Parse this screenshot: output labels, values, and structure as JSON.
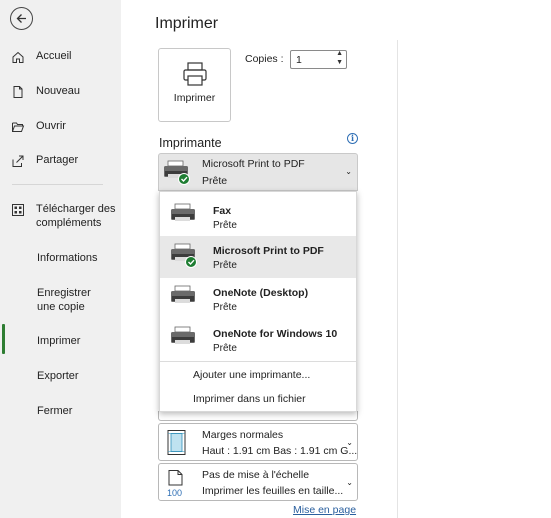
{
  "sidebar": {
    "back_label": "",
    "items": [
      {
        "label": "Accueil",
        "icon": "home-icon"
      },
      {
        "label": "Nouveau",
        "icon": "new-document-icon"
      },
      {
        "label": "Ouvrir",
        "icon": "folder-open-icon"
      },
      {
        "label": "Partager",
        "icon": "share-icon"
      },
      {
        "label": "Télécharger des compléments",
        "icon": "addins-icon"
      },
      {
        "label": "Informations"
      },
      {
        "label": "Enregistrer une copie"
      },
      {
        "label": "Imprimer",
        "active": true
      },
      {
        "label": "Exporter"
      },
      {
        "label": "Fermer"
      }
    ]
  },
  "main": {
    "title": "Imprimer",
    "print_button_label": "Imprimer",
    "copies_label": "Copies :",
    "copies_value": "1",
    "printer_section_title": "Imprimante",
    "selected_printer": {
      "name": "Microsoft Print to PDF",
      "status": "Prête"
    },
    "dropdown": {
      "printers": [
        {
          "name": "Fax",
          "status": "Prête"
        },
        {
          "name": "Microsoft Print to PDF",
          "status": "Prête",
          "selected": true
        },
        {
          "name": "OneNote (Desktop)",
          "status": "Prête"
        },
        {
          "name": "OneNote for Windows 10",
          "status": "Prête"
        }
      ],
      "add_printer": "Ajouter une imprimante...",
      "print_to_file": "Imprimer dans un fichier"
    },
    "margins": {
      "name": "Marges normales",
      "detail": "Haut : 1.91 cm Bas : 1.91 cm G..."
    },
    "scaling": {
      "name": "Pas de mise à l'échelle",
      "detail": "Imprimer les feuilles en taille...",
      "icon_text": "100"
    },
    "page_setup_link": "Mise en page"
  },
  "colors": {
    "accent_green": "#2e7d32",
    "link_blue": "#2a5f9e",
    "sidebar_bg": "#f0f0f0"
  }
}
